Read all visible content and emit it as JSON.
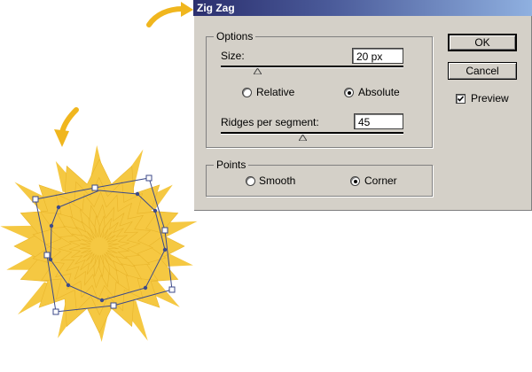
{
  "dialog": {
    "title": "Zig Zag",
    "options": {
      "legend": "Options",
      "size_label": "Size:",
      "size_value": "20 px",
      "size_slider_fraction": 0.2,
      "relative_label": "Relative",
      "absolute_label": "Absolute",
      "mode_selected": "Absolute",
      "ridges_label": "Ridges per segment:",
      "ridges_value": "45",
      "ridges_slider_fraction": 0.45
    },
    "points": {
      "legend": "Points",
      "smooth_label": "Smooth",
      "corner_label": "Corner",
      "selected": "Corner"
    },
    "buttons": {
      "ok": "OK",
      "cancel": "Cancel"
    },
    "preview": {
      "label": "Preview",
      "checked": true
    }
  },
  "artwork": {
    "fill_color": "#f5c842",
    "path_color": "#3c4a8a",
    "arrow_color": "#f0b61e"
  }
}
